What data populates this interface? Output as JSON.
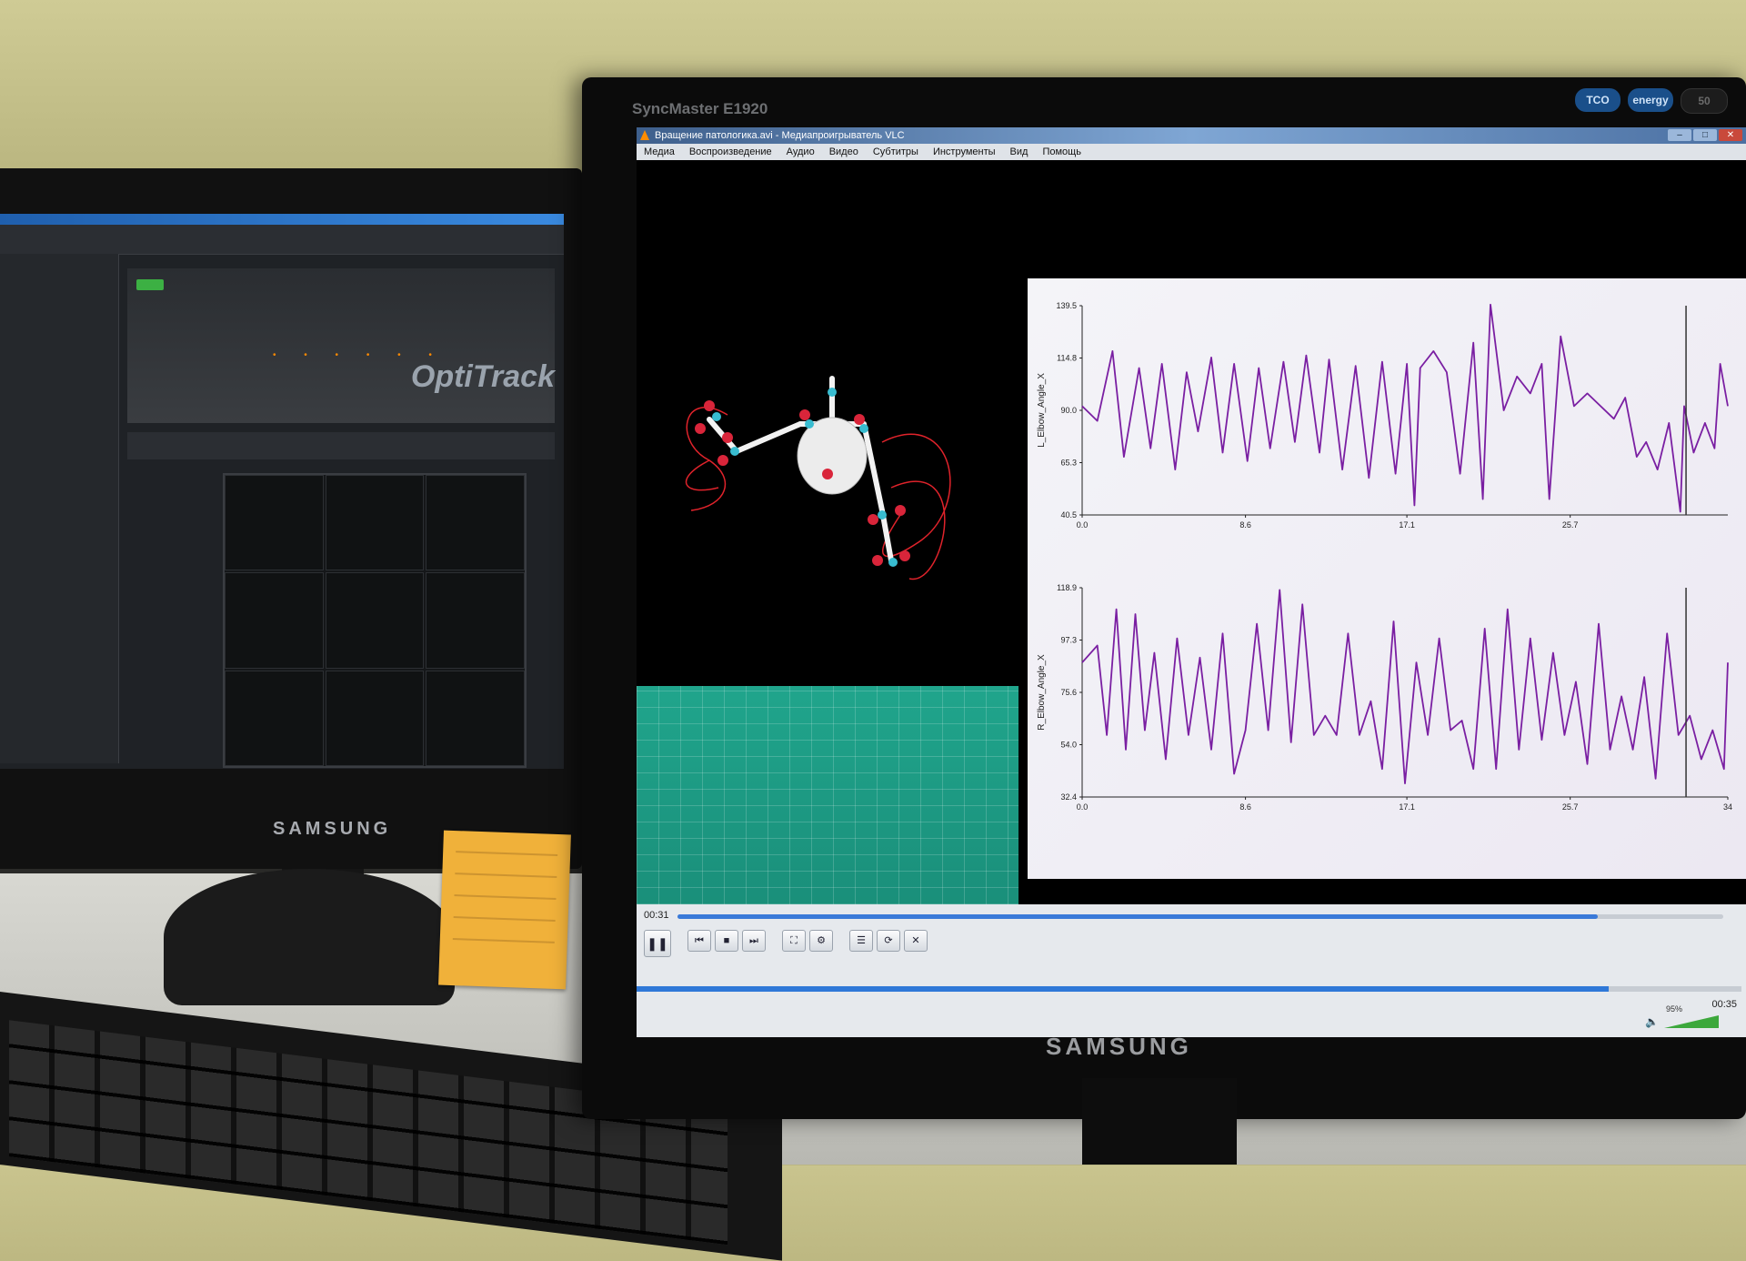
{
  "vlc": {
    "window_title": "Вращение патологика.avi - Медиапроигрыватель VLC",
    "menu": [
      "Медиа",
      "Воспроизведение",
      "Аудио",
      "Видео",
      "Субтитры",
      "Инструменты",
      "Вид",
      "Помощь"
    ],
    "time_elapsed": "00:31",
    "time_total": "00:35",
    "volume": "95%",
    "playback_progress": 0.88
  },
  "monitors": {
    "right_model": "SyncMaster E1920",
    "brand": "SAMSUNG",
    "badge_tco": "TCO",
    "badge_energy": "energy",
    "badge_right": "50"
  },
  "left_app": {
    "logo_text": "OptiTrack"
  },
  "chart_data": [
    {
      "type": "line",
      "ylabel": "L_Elbow_Angle_X",
      "yticks": [
        "139.5",
        "114.8",
        "90.0",
        "65.3",
        "40.5"
      ],
      "xticks": [
        "0.0",
        "8.6",
        "17.1",
        "25.7"
      ],
      "ylim": [
        40.5,
        139.5
      ],
      "xlim": [
        0,
        34
      ],
      "series": [
        {
          "color": "#7a1fa2",
          "x": [
            0,
            0.8,
            1.6,
            2.2,
            3,
            3.6,
            4.2,
            4.9,
            5.5,
            6.1,
            6.8,
            7.4,
            8,
            8.7,
            9.3,
            9.9,
            10.6,
            11.2,
            11.8,
            12.5,
            13,
            13.7,
            14.4,
            15.1,
            15.8,
            16.5,
            17.1,
            17.5,
            17.8,
            18.5,
            19.2,
            19.9,
            20.6,
            21.1,
            21.5,
            22.2,
            22.9,
            23.6,
            24.2,
            24.6,
            25.2,
            25.9,
            26.6,
            27.3,
            28,
            28.6,
            29.2,
            29.7,
            30.3,
            30.9,
            31.5,
            31.7,
            32.2,
            32.8,
            33.3,
            33.6,
            34
          ],
          "values": [
            92,
            85,
            118,
            68,
            110,
            72,
            112,
            62,
            108,
            80,
            115,
            70,
            112,
            66,
            110,
            72,
            113,
            75,
            116,
            70,
            114,
            62,
            111,
            58,
            113,
            60,
            112,
            45,
            110,
            118,
            108,
            60,
            122,
            48,
            140,
            90,
            106,
            98,
            112,
            48,
            125,
            92,
            98,
            92,
            86,
            96,
            68,
            75,
            62,
            84,
            42,
            92,
            70,
            84,
            72,
            112,
            92
          ]
        }
      ]
    },
    {
      "type": "line",
      "ylabel": "R_Elbow_Angle_X",
      "yticks": [
        "118.9",
        "97.3",
        "75.6",
        "54.0",
        "32.4"
      ],
      "xticks": [
        "0.0",
        "8.6",
        "17.1",
        "25.7",
        "34"
      ],
      "ylim": [
        32.4,
        118.9
      ],
      "xlim": [
        0,
        34
      ],
      "series": [
        {
          "color": "#7a1fa2",
          "x": [
            0,
            0.8,
            1.3,
            1.8,
            2.3,
            2.8,
            3.3,
            3.8,
            4.4,
            5,
            5.6,
            6.2,
            6.8,
            7.4,
            8,
            8.6,
            9.2,
            9.8,
            10.4,
            11,
            11.6,
            12.2,
            12.8,
            13.4,
            14,
            14.6,
            15.2,
            15.8,
            16.4,
            17,
            17.6,
            18.2,
            18.8,
            19.4,
            20,
            20.6,
            21.2,
            21.8,
            22.4,
            23,
            23.6,
            24.2,
            24.8,
            25.4,
            26,
            26.6,
            27.2,
            27.8,
            28.4,
            29,
            29.6,
            30.2,
            30.8,
            31.4,
            32,
            32.6,
            33.2,
            33.8,
            34
          ],
          "values": [
            88,
            95,
            58,
            110,
            52,
            108,
            60,
            92,
            48,
            98,
            58,
            90,
            52,
            100,
            42,
            60,
            104,
            60,
            118,
            55,
            112,
            58,
            66,
            58,
            100,
            58,
            72,
            44,
            105,
            38,
            88,
            58,
            98,
            60,
            64,
            44,
            102,
            44,
            110,
            52,
            98,
            56,
            92,
            58,
            80,
            46,
            104,
            52,
            74,
            52,
            82,
            40,
            100,
            58,
            66,
            48,
            60,
            44,
            88
          ]
        }
      ]
    }
  ]
}
